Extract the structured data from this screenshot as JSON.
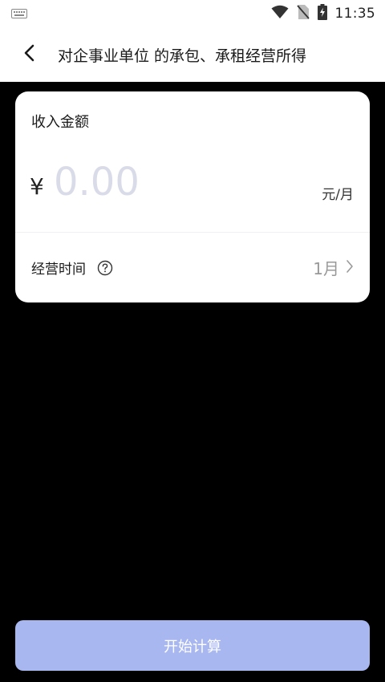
{
  "status_bar": {
    "time": "11:35",
    "icons": [
      "keyboard-icon",
      "wifi-icon",
      "no-sim-icon",
      "battery-charging-icon"
    ]
  },
  "header": {
    "title": "对企事业单位 的承包、承租经营所得",
    "back_icon": "chevron-left-icon"
  },
  "form": {
    "income_label": "收入金额",
    "currency_symbol": "¥",
    "amount_placeholder": "0.00",
    "amount_value": "",
    "unit": "元/月",
    "period_label": "经营时间",
    "period_help_icon": "question-circle-icon",
    "period_value": "1月",
    "period_chevron_icon": "chevron-right-icon"
  },
  "actions": {
    "calculate_label": "开始计算"
  },
  "colors": {
    "background": "#000000",
    "card": "#ffffff",
    "button": "#a9b7f1",
    "placeholder": "#d9dce8"
  }
}
